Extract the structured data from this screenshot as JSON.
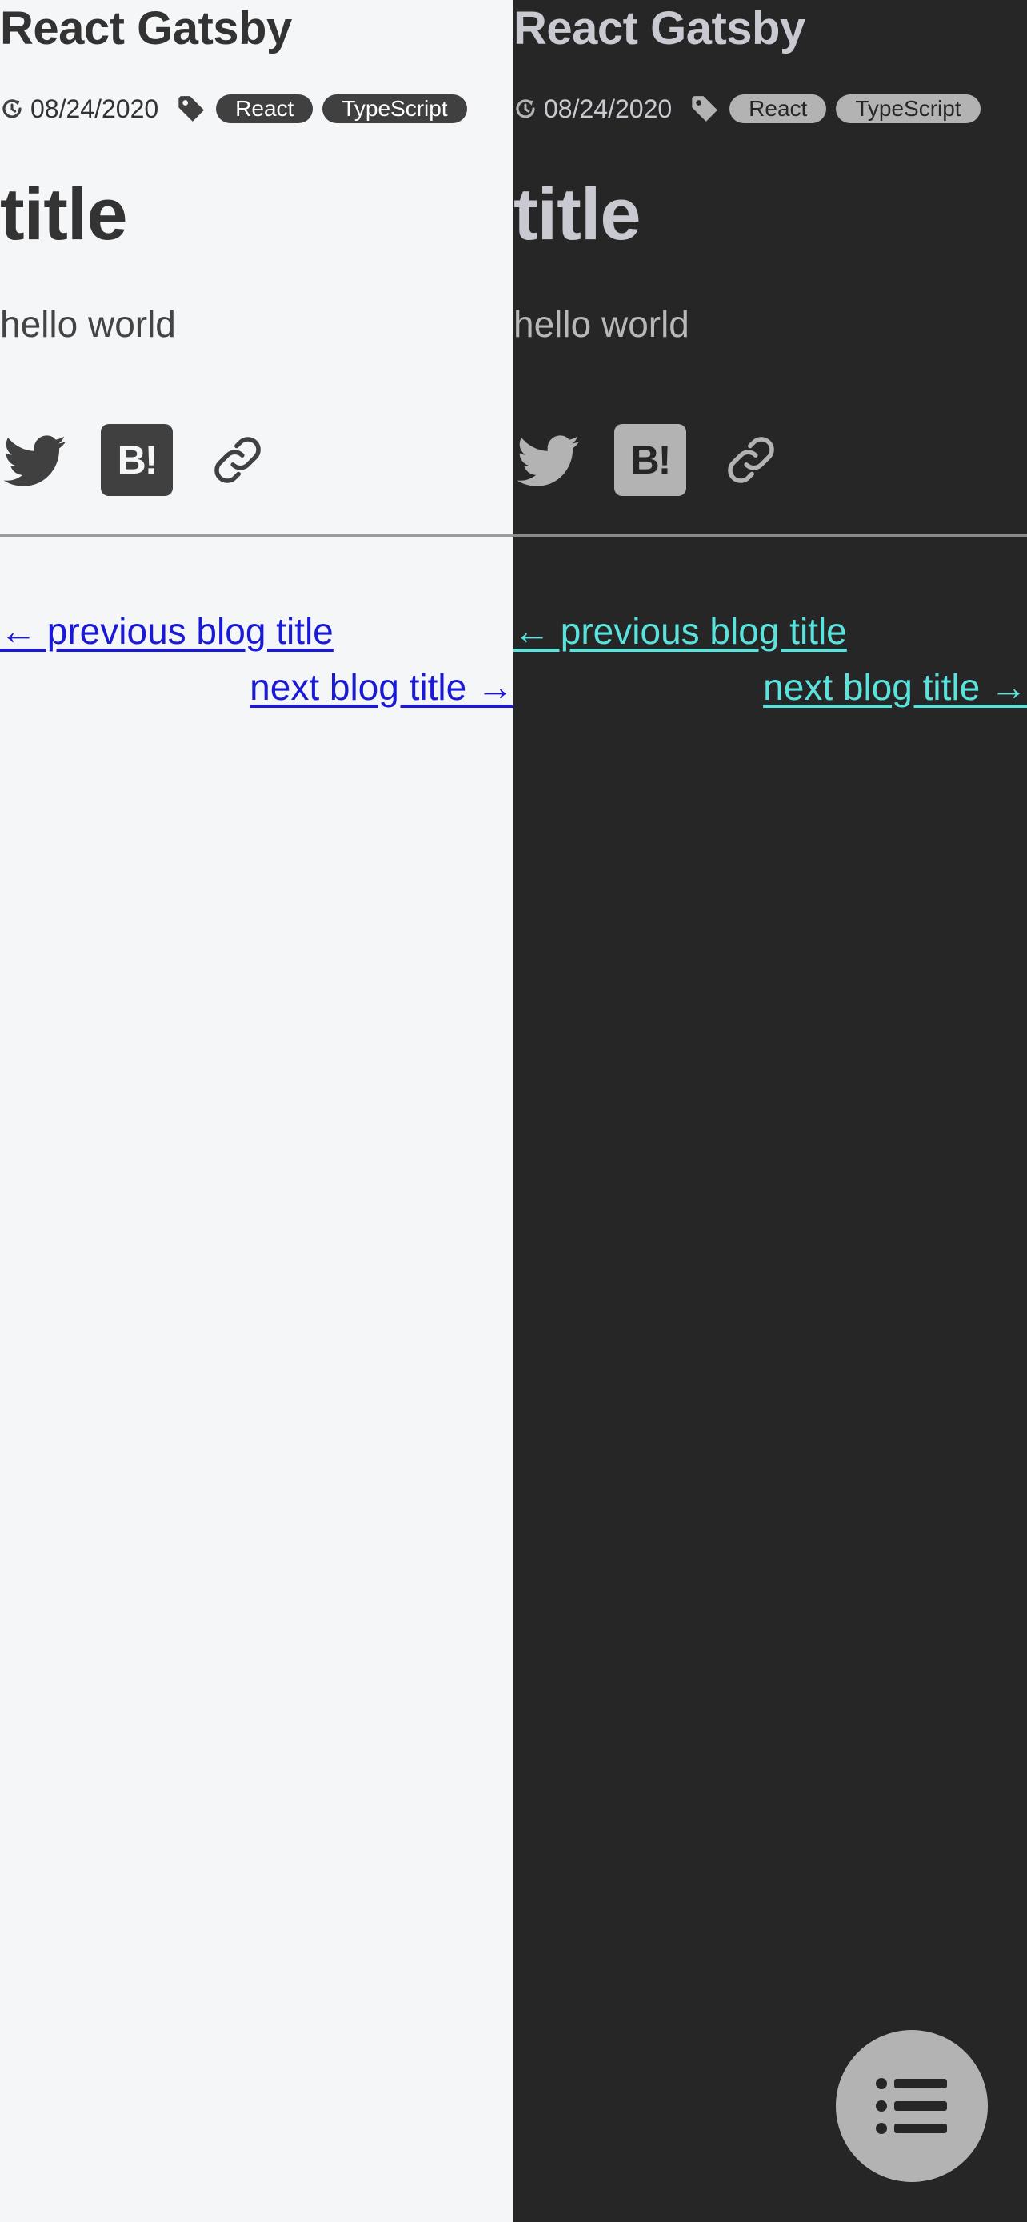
{
  "panels": {
    "light": {
      "site_title": "React Gatsby",
      "date": "08/24/2020",
      "tags": [
        "React",
        "TypeScript"
      ],
      "post_title": "title",
      "post_body": "hello world",
      "share": {
        "hatena_label": "B!"
      },
      "nav": {
        "previous": "← previous blog title",
        "next": "next blog title →"
      }
    },
    "dark": {
      "site_title": "React Gatsby",
      "date": "08/24/2020",
      "tags": [
        "React",
        "TypeScript"
      ],
      "post_title": "title",
      "post_body": "hello world",
      "share": {
        "hatena_label": "B!"
      },
      "nav": {
        "previous": "← previous blog title",
        "next": "next blog title →"
      }
    }
  },
  "icons": {
    "date": "clock-icon",
    "tags": "tag-icon",
    "share_twitter": "twitter-icon",
    "share_hatena": "hatena-bookmark-icon",
    "share_link": "link-icon",
    "toc": "list-icon"
  },
  "colors": {
    "light_background": "#f5f6f8",
    "dark_background": "#262626",
    "light_link": "#1a1ad6",
    "dark_link": "#5ae3dd",
    "light_icon": "#404040",
    "dark_icon": "#b3b3b3",
    "toc_button": "#b3b3b3"
  }
}
